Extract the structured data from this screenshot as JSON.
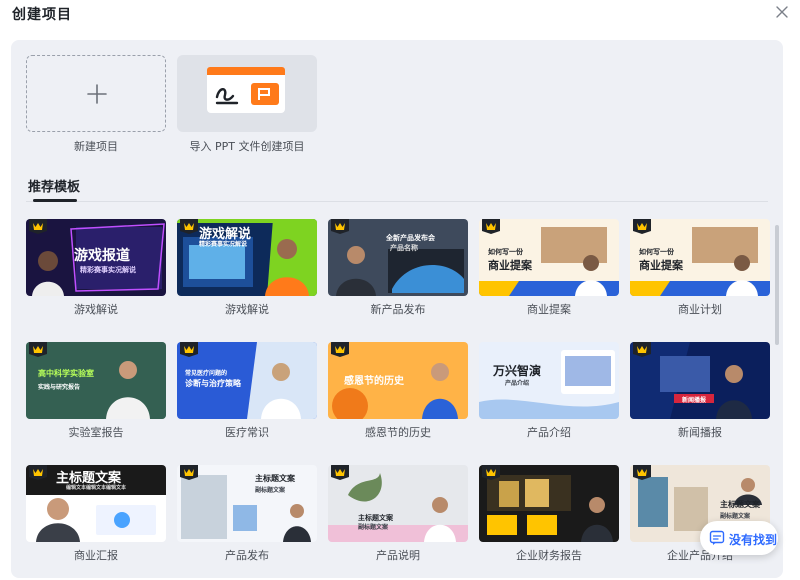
{
  "dialog": {
    "title": "创建项目",
    "close_icon": "close-icon"
  },
  "create": {
    "new_label": "新建项目",
    "import_label": "导入 PPT 文件创建项目"
  },
  "templates_section": {
    "title": "推荐模板"
  },
  "templates": [
    {
      "label": "游戏解说",
      "overlay": "游戏报道",
      "sub": "精彩赛事实况解说"
    },
    {
      "label": "游戏解说",
      "overlay": "游戏解说",
      "sub": "精彩赛事实况解说"
    },
    {
      "label": "新产品发布",
      "overlay": "全新产品发布会",
      "sub": "产品名称"
    },
    {
      "label": "商业提案",
      "overlay": "商业提案",
      "sub": "如何写一份"
    },
    {
      "label": "商业计划",
      "overlay": "商业提案",
      "sub": "如何写一份"
    },
    {
      "label": "实验室报告",
      "overlay": "高中科学实验室",
      "sub": "实践与研究报告"
    },
    {
      "label": "医疗常识",
      "overlay": "诊断与治疗策略",
      "sub": "常见医疗问题的"
    },
    {
      "label": "感恩节的历史",
      "overlay": "感恩节的历史",
      "sub": ""
    },
    {
      "label": "产品介绍",
      "overlay": "万兴智演",
      "sub": "产品介绍"
    },
    {
      "label": "新闻播报",
      "overlay": "新闻播报",
      "sub": ""
    },
    {
      "label": "商业汇报",
      "overlay": "主标题文案",
      "sub": "编辑文本编辑文本编辑文本"
    },
    {
      "label": "产品发布",
      "overlay": "主标题文案",
      "sub": "副标题文案"
    },
    {
      "label": "产品说明",
      "overlay": "主标题文案",
      "sub": "副标题文案"
    },
    {
      "label": "企业财务报告",
      "overlay": "",
      "sub": ""
    },
    {
      "label": "企业产品介绍",
      "overlay": "主标题文案",
      "sub": "副标题文案"
    }
  ],
  "feedback": {
    "label": "没有找到"
  },
  "colors": {
    "accent": "#2f6bff",
    "panel_bg": "#eef0f5",
    "ppt_orange": "#ff7a1a",
    "crown": "#ffc400"
  }
}
